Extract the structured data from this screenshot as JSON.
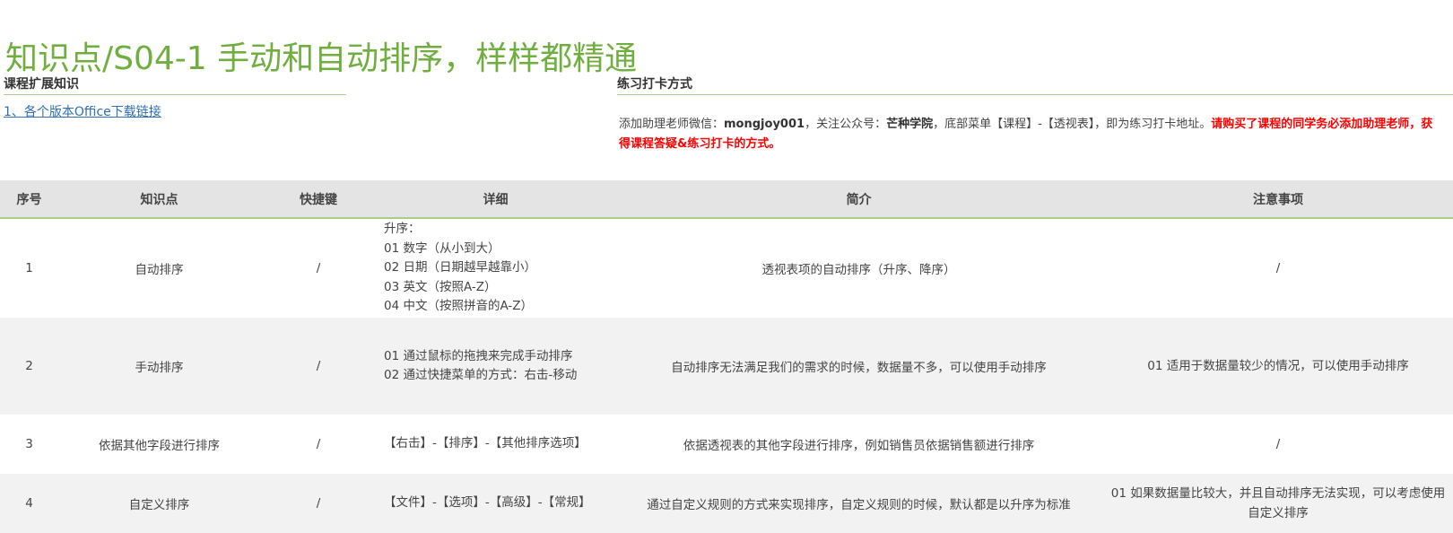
{
  "title": "知识点/S04-1 手动和自动排序，样样都精通",
  "left_section": {
    "heading": "课程扩展知识",
    "link": "1、各个版本Office下载链接"
  },
  "right_section": {
    "heading": "练习打卡方式",
    "note_prefix": "添加助理老师微信：",
    "wechat_id": "mongjoy001",
    "note_mid1": "，关注公众号：",
    "account": "芒种学院",
    "note_mid2": "，底部菜单【课程】-【透视表】，即为练习打卡地址。",
    "note_red": "请购买了课程的同学务必添加助理老师，获得课程答疑&练习打卡的方式。"
  },
  "table": {
    "headers": {
      "no": "序号",
      "topic": "知识点",
      "shortcut": "快捷键",
      "detail": "详细",
      "summary": "简介",
      "notes": "注意事项"
    },
    "rows": [
      {
        "no": "1",
        "topic": "自动排序",
        "shortcut": "/",
        "detail": [
          "升序：",
          "01 数字（从小到大）",
          "02 日期（日期越早越靠小）",
          "03 英文（按照A-Z）",
          "04 中文（按照拼音的A-Z）"
        ],
        "summary": "透视表项的自动排序（升序、降序）",
        "notes": "/"
      },
      {
        "no": "2",
        "topic": "手动排序",
        "shortcut": "/",
        "detail": [
          "01 通过鼠标的拖拽来完成手动排序",
          "02 通过快捷菜单的方式：右击-移动"
        ],
        "summary": "自动排序无法满足我们的需求的时候，数据量不多，可以使用手动排序",
        "notes": "01 适用于数据量较少的情况，可以使用手动排序"
      },
      {
        "no": "3",
        "topic": "依据其他字段进行排序",
        "shortcut": "/",
        "detail": [
          "【右击】-【排序】-【其他排序选项】"
        ],
        "summary": "依据透视表的其他字段进行排序，例如销售员依据销售额进行排序",
        "notes": "/"
      },
      {
        "no": "4",
        "topic": "自定义排序",
        "shortcut": "/",
        "detail": [
          "【文件】-【选项】-【高级】-【常规】"
        ],
        "summary": "通过自定义规则的方式来实现排序，自定义规则的时候，默认都是以升序为标准",
        "notes": "01 如果数据量比较大，并且自动排序无法实现，可以考虑使用自定义排序"
      }
    ]
  }
}
